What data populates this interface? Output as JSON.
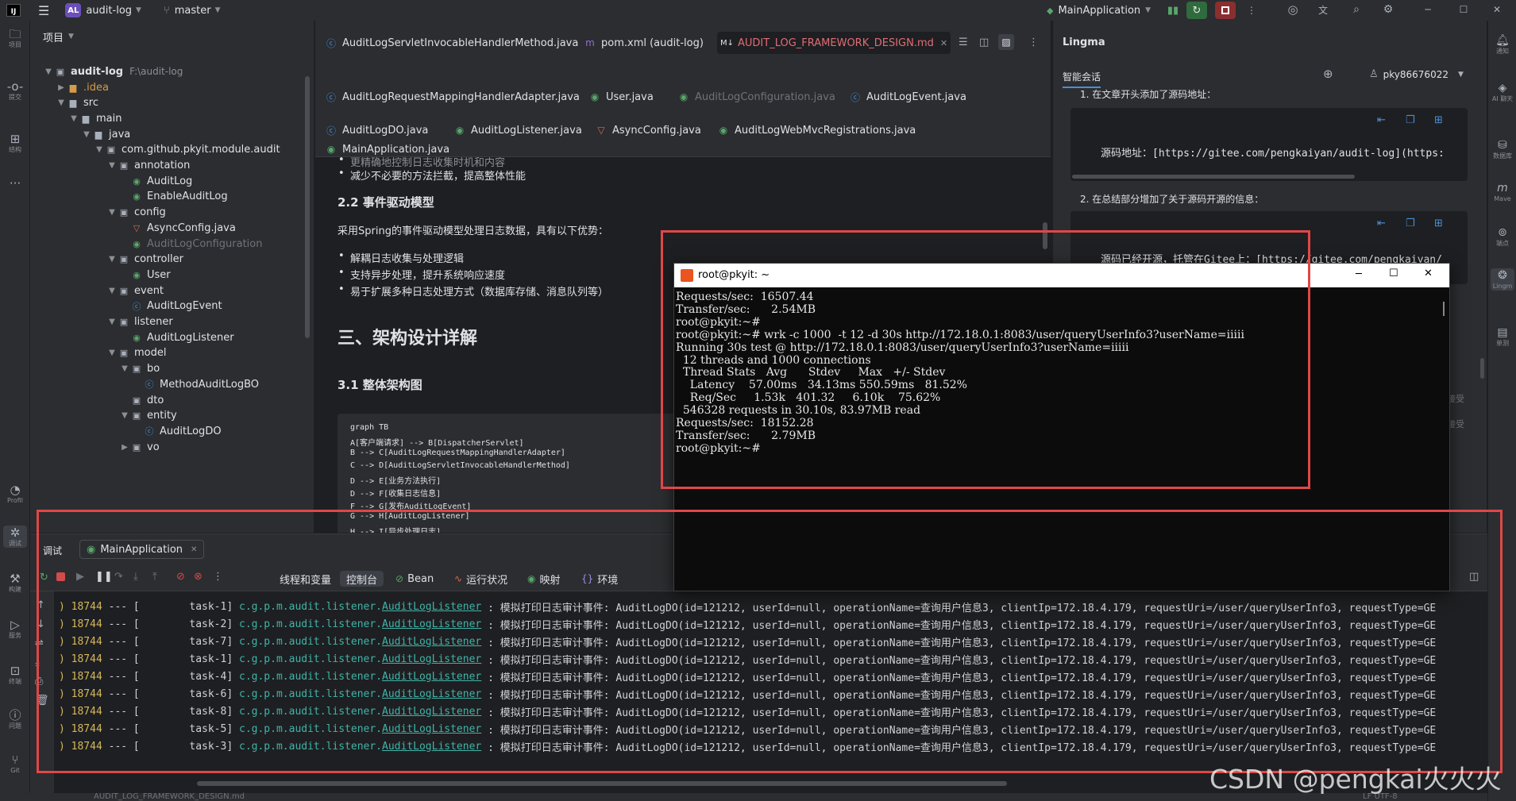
{
  "titlebar": {
    "app_logo": "IJ",
    "project_badge": "AL",
    "project_name": "audit-log",
    "branch": "master",
    "run_config": "MainApplication"
  },
  "left_strip": [
    {
      "icon": "folder-icon",
      "label": "项目"
    },
    {
      "icon": "commit-icon",
      "label": "提交"
    },
    {
      "icon": "structure-icon",
      "label": "结构"
    },
    {
      "icon": "more-icon",
      "label": ""
    },
    {
      "icon": "profiler-icon",
      "label": "Profil"
    },
    {
      "icon": "debug-icon",
      "label": "调试"
    },
    {
      "icon": "build-icon",
      "label": "构建"
    },
    {
      "icon": "services-icon",
      "label": "服务"
    },
    {
      "icon": "terminal-icon",
      "label": "终端"
    },
    {
      "icon": "problems-icon",
      "label": "问题"
    },
    {
      "icon": "git-icon",
      "label": "Git"
    }
  ],
  "project_panel": {
    "title": "项目",
    "root_name": "audit-log",
    "root_path": "F:\\audit-log",
    "tree": [
      {
        "depth": 1,
        "arrow": "▶",
        "icon": "folder",
        "label": ".idea",
        "color": "orange"
      },
      {
        "depth": 1,
        "arrow": "▼",
        "icon": "folder",
        "label": "src"
      },
      {
        "depth": 2,
        "arrow": "▼",
        "icon": "folder",
        "label": "main"
      },
      {
        "depth": 3,
        "arrow": "▼",
        "icon": "folder",
        "label": "java"
      },
      {
        "depth": 4,
        "arrow": "▼",
        "icon": "package",
        "label": "com.github.pkyit.module.audit"
      },
      {
        "depth": 5,
        "arrow": "▼",
        "icon": "package",
        "label": "annotation"
      },
      {
        "depth": 6,
        "arrow": "",
        "icon": "anno",
        "label": "AuditLog"
      },
      {
        "depth": 6,
        "arrow": "",
        "icon": "anno",
        "label": "EnableAuditLog"
      },
      {
        "depth": 5,
        "arrow": "▼",
        "icon": "package",
        "label": "config"
      },
      {
        "depth": 6,
        "arrow": "",
        "icon": "cfg",
        "label": "AsyncConfig.java"
      },
      {
        "depth": 6,
        "arrow": "",
        "icon": "anno",
        "label": "AuditLogConfiguration",
        "color": "dim"
      },
      {
        "depth": 5,
        "arrow": "▼",
        "icon": "package",
        "label": "controller"
      },
      {
        "depth": 6,
        "arrow": "",
        "icon": "anno",
        "label": "User"
      },
      {
        "depth": 5,
        "arrow": "▼",
        "icon": "package",
        "label": "event"
      },
      {
        "depth": 6,
        "arrow": "",
        "icon": "class",
        "label": "AuditLogEvent"
      },
      {
        "depth": 5,
        "arrow": "▼",
        "icon": "package",
        "label": "listener"
      },
      {
        "depth": 6,
        "arrow": "",
        "icon": "anno",
        "label": "AuditLogListener"
      },
      {
        "depth": 5,
        "arrow": "▼",
        "icon": "package",
        "label": "model"
      },
      {
        "depth": 6,
        "arrow": "▼",
        "icon": "package",
        "label": "bo"
      },
      {
        "depth": 7,
        "arrow": "",
        "icon": "class",
        "label": "MethodAuditLogBO"
      },
      {
        "depth": 6,
        "arrow": "",
        "icon": "package",
        "label": "dto"
      },
      {
        "depth": 6,
        "arrow": "▼",
        "icon": "package",
        "label": "entity"
      },
      {
        "depth": 7,
        "arrow": "",
        "icon": "class",
        "label": "AuditLogDO"
      },
      {
        "depth": 6,
        "arrow": "▶",
        "icon": "package",
        "label": "vo"
      }
    ]
  },
  "editor_tabs": [
    {
      "label": "AuditLogServletInvocableHandlerMethod.java",
      "icon": "class",
      "state": "normal"
    },
    {
      "label": "pom.xml (audit-log)",
      "icon": "maven",
      "state": "normal"
    },
    {
      "label": "AUDIT_LOG_FRAMEWORK_DESIGN.md",
      "icon": "md",
      "state": "active"
    },
    {
      "label": "AuditLogRequestMappingHandlerAdapter.java",
      "icon": "class",
      "state": "normal"
    },
    {
      "label": "User.java",
      "icon": "anno",
      "state": "normal"
    },
    {
      "label": "AuditLogConfiguration.java",
      "icon": "anno",
      "state": "dim"
    },
    {
      "label": "AuditLogEvent.java",
      "icon": "class",
      "state": "normal"
    },
    {
      "label": "AuditLogDO.java",
      "icon": "class",
      "state": "normal"
    },
    {
      "label": "AuditLogListener.java",
      "icon": "anno",
      "state": "normal"
    },
    {
      "label": "AsyncConfig.java",
      "icon": "cfg",
      "state": "normal"
    },
    {
      "label": "AuditLogWebMvcRegistrations.java",
      "icon": "anno",
      "state": "normal"
    },
    {
      "label": "MainApplication.java",
      "icon": "anno",
      "state": "normal"
    }
  ],
  "markdown": {
    "partial_bullet": "更精确地控制日志收集时机和内容",
    "bullet_top": "减少不必要的方法拦截，提高整体性能",
    "h_2_2": "2.2 事件驱动模型",
    "p_2_2": "采用Spring的事件驱动模型处理日志数据，具有以下优势：",
    "bullets_2_2": [
      "解耦日志收集与处理逻辑",
      "支持异步处理，提升系统响应速度",
      "易于扩展多种日志处理方式（数据库存储、消息队列等）"
    ],
    "h_3": "三、架构设计详解",
    "h_3_1": "3.1 整体架构图",
    "code": [
      "graph TB",
      "    A[客户端请求] --> B[DispatcherServlet]",
      "    B --> C[AuditLogRequestMappingHandlerAdapter]",
      "    C --> D[AuditLogServletInvocableHandlerMethod]",
      "    D --> E[业务方法执行]",
      "    D --> F[收集日志信息]",
      "    F --> G[发布AuditLogEvent]",
      "    G --> H[AuditLogListener]",
      "    H --> I[异步处理日志]"
    ]
  },
  "lingma": {
    "title": "Lingma",
    "tab": "智能会话",
    "user": "pky86676022",
    "item1": "1. 在文章开头添加了源码地址：",
    "code1": "源码地址：[https://gitee.com/pengkaiyan/audit-log](https:",
    "item2": "2. 在总结部分增加了关于源码开源的信息：",
    "code2": "源码已经开源，托管在Gitee上：[https://gitee.com/pengkaiyan/",
    "side_text_1": "接受",
    "side_text_2": "接受"
  },
  "right_strip": [
    {
      "icon": "notification-icon",
      "label": "通知"
    },
    {
      "icon": "ai-chat-icon",
      "label": "AI 聊天"
    },
    {
      "icon": "database-icon",
      "label": "数据库"
    },
    {
      "icon": "maven-icon",
      "label": "Mave"
    },
    {
      "icon": "endpoints-icon",
      "label": "端点"
    },
    {
      "icon": "lingma-icon",
      "label": "Lingm"
    },
    {
      "icon": "unit-test-icon",
      "label": "单测"
    }
  ],
  "debug": {
    "title": "调试",
    "session": "MainApplication",
    "tabs": [
      "线程和变量",
      "控制台",
      "Bean",
      "运行状况",
      "映射",
      "环境"
    ],
    "active_tab": "控制台",
    "console": [
      {
        "pid": "18744",
        "task": "task-1"
      },
      {
        "pid": "18744",
        "task": "task-2"
      },
      {
        "pid": "18744",
        "task": "task-7"
      },
      {
        "pid": "18744",
        "task": "task-1"
      },
      {
        "pid": "18744",
        "task": "task-4"
      },
      {
        "pid": "18744",
        "task": "task-6"
      },
      {
        "pid": "18744",
        "task": "task-8"
      },
      {
        "pid": "18744",
        "task": "task-5"
      },
      {
        "pid": "18744",
        "task": "task-3"
      }
    ],
    "logger_pkg": "c.g.p.m.audit.listener.",
    "logger_cls": "AuditLogListener",
    "message": " : 模拟打印日志审计事件: AuditLogDO(id=121212, userId=null, operationName=查询用户信息3, clientIp=172.18.4.179, requestUri=/user/queryUserInfo3, requestType=GE"
  },
  "terminal": {
    "title": "root@pkyit: ~",
    "lines": [
      "Requests/sec:  16507.44",
      "Transfer/sec:      2.54MB",
      "root@pkyit:~#",
      "root@pkyit:~# wrk -c 1000  -t 12 -d 30s http://172.18.0.1:8083/user/queryUserInfo3?userName=iiiii",
      "Running 30s test @ http://172.18.0.1:8083/user/queryUserInfo3?userName=iiiii",
      "  12 threads and 1000 connections",
      "  Thread Stats   Avg      Stdev     Max   +/- Stdev",
      "    Latency    57.00ms   34.13ms 550.59ms   81.52%",
      "    Req/Sec     1.53k   401.32     6.10k    75.62%",
      "  546328 requests in 30.10s, 83.97MB read",
      "Requests/sec:  18152.28",
      "Transfer/sec:      2.79MB",
      "root@pkyit:~#"
    ]
  },
  "watermark": "CSDN @pengkai火火火",
  "statusbar": {
    "breadcrumb": "AUDIT_LOG_FRAMEWORK_DESIGN.md",
    "encoding": "LF  UTF-8"
  }
}
